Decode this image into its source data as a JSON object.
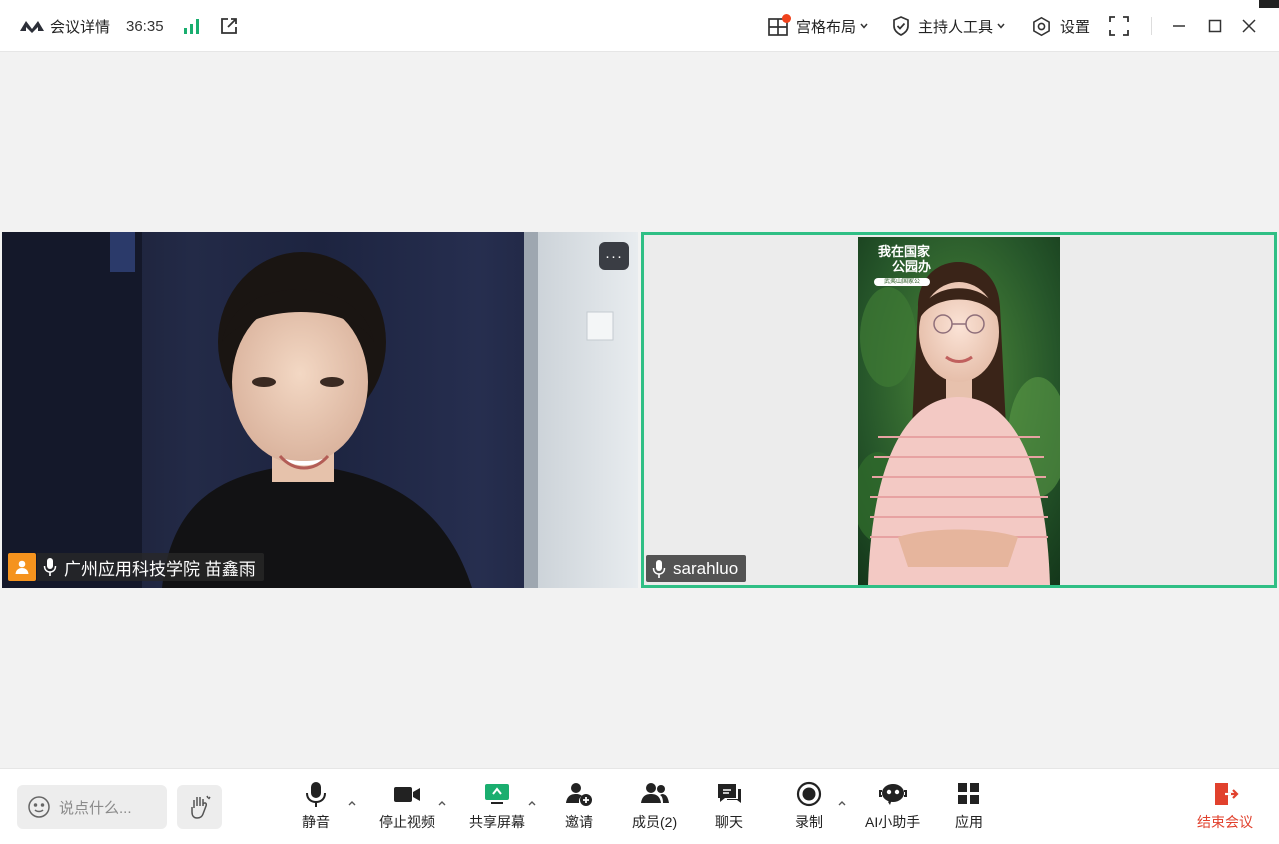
{
  "topbar": {
    "meeting_details": "会议详情",
    "timer": "36:35",
    "layout_label": "宫格布局",
    "host_tools_label": "主持人工具",
    "settings_label": "设置"
  },
  "participants": [
    {
      "name": "广州应用科技学院  苗鑫雨",
      "role_badge": "host"
    },
    {
      "name": "sarahluo",
      "active_speaker": true
    }
  ],
  "video_overlay_text": {
    "line1": "我在国家",
    "line2": "公园办",
    "line3": "武夷山国家公"
  },
  "bottombar": {
    "chat_placeholder": "说点什么...",
    "tools": [
      {
        "label": "静音",
        "icon": "mic-icon"
      },
      {
        "label": "停止视频",
        "icon": "camera-icon"
      },
      {
        "label": "共享屏幕",
        "icon": "share-screen-icon"
      },
      {
        "label": "邀请",
        "icon": "invite-icon"
      },
      {
        "label": "成员(2)",
        "icon": "members-icon"
      },
      {
        "label": "聊天",
        "icon": "chat-icon"
      },
      {
        "label": "录制",
        "icon": "record-icon"
      },
      {
        "label": "AI小助手",
        "icon": "ai-assistant-icon"
      },
      {
        "label": "应用",
        "icon": "apps-icon"
      }
    ],
    "end_label": "结束会议"
  },
  "colors": {
    "accent": "#2fbf85",
    "end": "#e1412d",
    "badge": "#f5931e",
    "signal": "#1aae6f"
  }
}
